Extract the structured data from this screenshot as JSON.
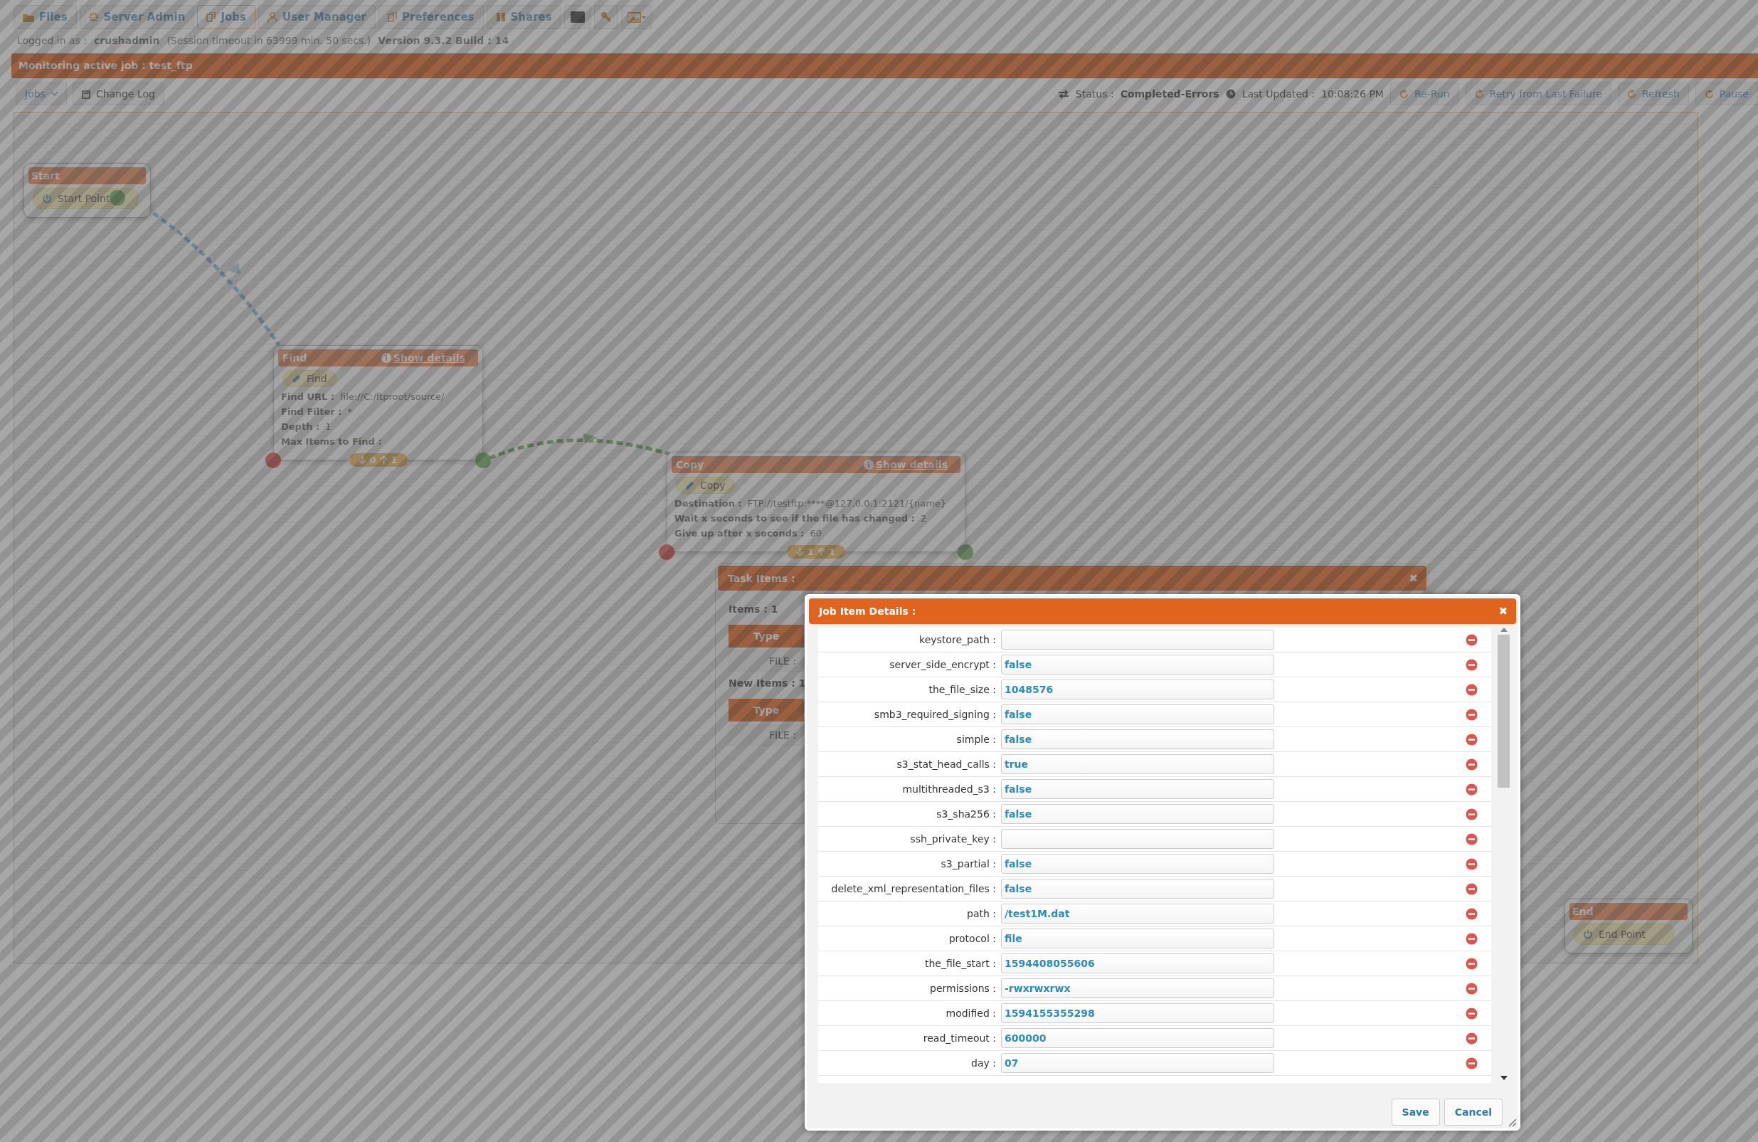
{
  "nav": [
    {
      "label": "Files",
      "selected": false
    },
    {
      "label": "Server Admin",
      "selected": false
    },
    {
      "label": "Jobs",
      "selected": true
    },
    {
      "label": "User Manager",
      "selected": false
    },
    {
      "label": "Preferences",
      "selected": false
    },
    {
      "label": "Shares",
      "selected": false
    }
  ],
  "session": {
    "logged_label": "Logged in as :",
    "user": "crushadmin",
    "timeout": "(Session timeout in 63999 min. 50 secs.)",
    "version": "Version 9.3.2 Build : 14"
  },
  "banner": "Monitoring active job : test_ftp",
  "toolbar": {
    "jobs_menu": "Jobs",
    "change_log": "Change Log",
    "status_label": "Status :",
    "status": "Completed-Errors",
    "updated_label": "Last Updated :",
    "updated": "10:08:26 PM",
    "actions": [
      "Re-Run",
      "Retry from Last Failure",
      "Refresh",
      "Pause"
    ]
  },
  "nodes": [
    {
      "kind": "endpoint",
      "title": "Start",
      "chip": "Start Point",
      "outlet": true
    },
    {
      "kind": "task",
      "title": "Find",
      "details_link": "Show details",
      "chip": "Find",
      "fields": [
        {
          "label": "Find URL :",
          "value": "file://C:/ftproot/source/"
        },
        {
          "label": "Find Filter :",
          "value": "*"
        },
        {
          "label": "Depth :",
          "value": "1"
        },
        {
          "label": "Max Items to Find :"
        }
      ],
      "counts": {
        "in": "0",
        "out": "1"
      }
    },
    {
      "kind": "task",
      "title": "Copy",
      "details_link": "Show details",
      "chip": "Copy",
      "fields": [
        {
          "label": "Destination :",
          "value": "FTP://testftp:****@127.0.0.1:2121/{name}"
        },
        {
          "label": "Wait x seconds to see if the file has changed :",
          "value": "2"
        },
        {
          "label": "Give up after x seconds :",
          "value": "60"
        }
      ],
      "counts": {
        "in": "1",
        "out": "1"
      }
    },
    {
      "kind": "endpoint",
      "title": "End",
      "chip": "End Point",
      "outlet": false
    }
  ],
  "task_items": {
    "title": "Task Items :",
    "close": "✖",
    "sections": [
      {
        "label": "Items : 1",
        "header": "Type",
        "rows": [
          "FILE :"
        ]
      },
      {
        "label": "New Items : 1",
        "header": "Type",
        "rows": [
          "FILE :"
        ]
      }
    ]
  },
  "job_item_details": {
    "title": "Job Item Details :",
    "close": "✖",
    "fields": [
      {
        "name": "keystore_path :"
      },
      {
        "name": "server_side_encrypt :",
        "value": "false"
      },
      {
        "name": "the_file_size :",
        "value": "1048576"
      },
      {
        "name": "smb3_required_signing :",
        "value": "false"
      },
      {
        "name": "simple :",
        "value": "false"
      },
      {
        "name": "s3_stat_head_calls :",
        "value": "true"
      },
      {
        "name": "multithreaded_s3 :",
        "value": "false"
      },
      {
        "name": "s3_sha256 :",
        "value": "false"
      },
      {
        "name": "ssh_private_key :"
      },
      {
        "name": "s3_partial :",
        "value": "false"
      },
      {
        "name": "delete_xml_representation_files :",
        "value": "false"
      },
      {
        "name": "path :",
        "value": "/test1M.dat"
      },
      {
        "name": "protocol :",
        "value": "file"
      },
      {
        "name": "the_file_start :",
        "value": "1594408055606"
      },
      {
        "name": "permissions :",
        "value": "-rwxrwxrwx"
      },
      {
        "name": "modified :",
        "value": "1594155355298"
      },
      {
        "name": "read_timeout :",
        "value": "600000"
      },
      {
        "name": "day :",
        "value": "07"
      }
    ],
    "buttons": [
      "Save",
      "Cancel"
    ]
  }
}
